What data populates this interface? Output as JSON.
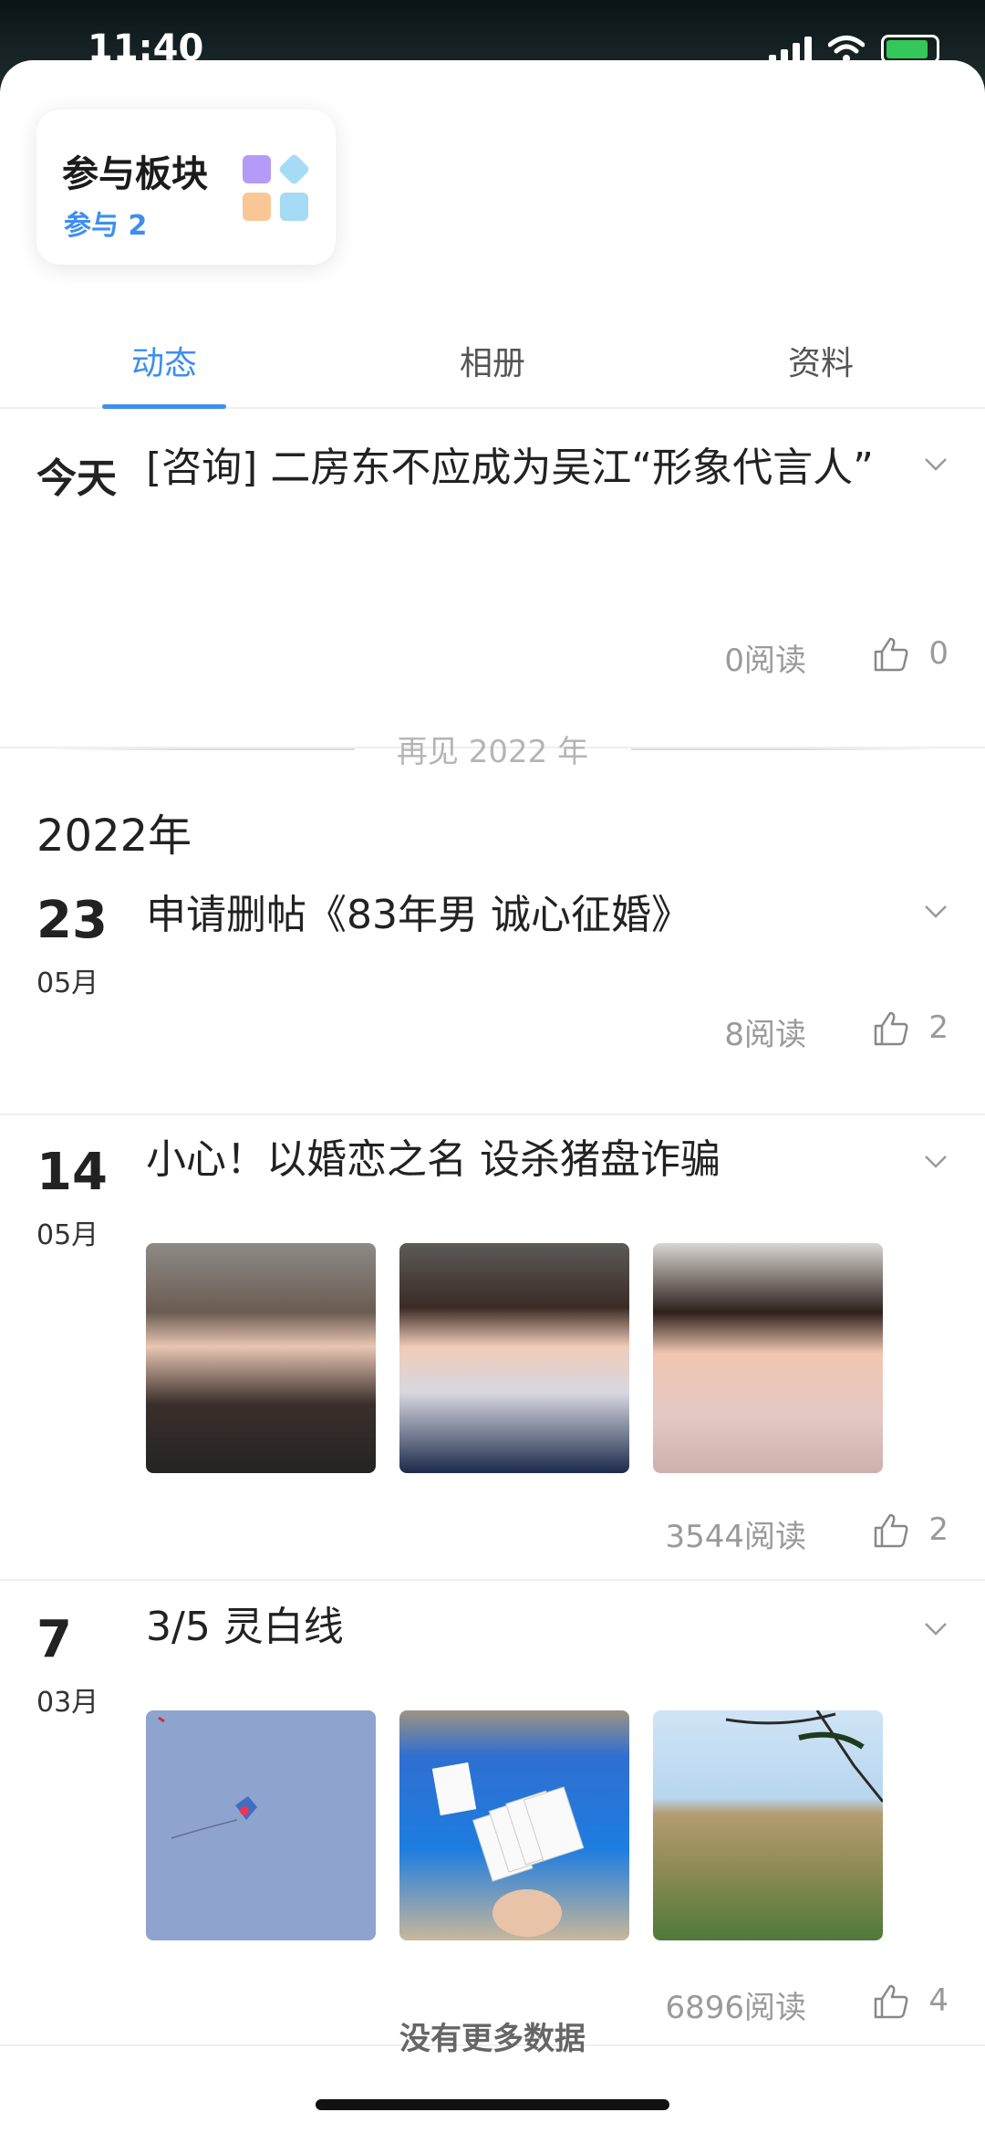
{
  "status": {
    "time": "11:40"
  },
  "board_card": {
    "title": "参与板块",
    "subtitle": "参与 2",
    "icon": "board-grid-icon",
    "colors": [
      "#a98cf5",
      "#8fd0f5",
      "#f7c28f",
      "#9ad7f5"
    ]
  },
  "tabs": [
    {
      "label": "动态",
      "active": true
    },
    {
      "label": "相册",
      "active": false
    },
    {
      "label": "资料",
      "active": false
    }
  ],
  "today_post": {
    "day_label": "今天",
    "title": "[咨询] 二房东不应成为吴江“形象代言人”",
    "reads": "0阅读",
    "likes": "0"
  },
  "year_divider": {
    "text": "再见 2022 年"
  },
  "year_heading": "2022年",
  "posts": [
    {
      "day": "23",
      "month": "05月",
      "title": "申请删帖《83年男 诚心征婚》",
      "reads": "8阅读",
      "likes": "2"
    },
    {
      "day": "14",
      "month": "05月",
      "title": "小心！以婚恋之名 设杀猪盘诈骗",
      "reads": "3544阅读",
      "likes": "2"
    },
    {
      "day": "7",
      "month": "03月",
      "title": "3/5 灵白线",
      "reads": "6896阅读",
      "likes": "4"
    }
  ],
  "footer": {
    "no_more": "没有更多数据"
  },
  "colors": {
    "accent": "#3d8ff0",
    "muted": "#9a9a9a"
  }
}
